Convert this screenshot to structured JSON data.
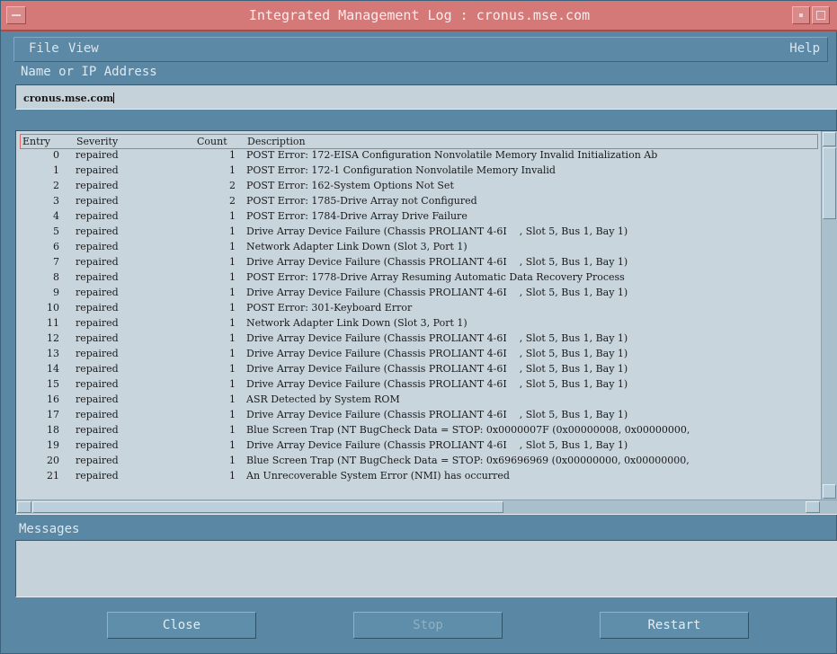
{
  "window": {
    "title": "Integrated Management Log : cronus.mse.com"
  },
  "menu": {
    "file": "File",
    "view": "View",
    "help": "Help"
  },
  "address": {
    "label": "Name or IP Address",
    "value": "cronus.mse.com"
  },
  "list": {
    "headers": {
      "entry": "Entry",
      "severity": "Severity",
      "count": "Count",
      "description": "Description"
    },
    "rows": [
      {
        "entry": "0",
        "severity": "repaired",
        "count": "1",
        "description": "POST Error: 172-EISA Configuration Nonvolatile Memory Invalid Initialization Ab"
      },
      {
        "entry": "1",
        "severity": "repaired",
        "count": "1",
        "description": "POST Error: 172-1 Configuration Nonvolatile Memory Invalid"
      },
      {
        "entry": "2",
        "severity": "repaired",
        "count": "2",
        "description": "POST Error: 162-System Options Not Set"
      },
      {
        "entry": "3",
        "severity": "repaired",
        "count": "2",
        "description": "POST Error: 1785-Drive Array not Configured"
      },
      {
        "entry": "4",
        "severity": "repaired",
        "count": "1",
        "description": "POST Error: 1784-Drive Array Drive Failure"
      },
      {
        "entry": "5",
        "severity": "repaired",
        "count": "1",
        "description": "Drive Array Device Failure (Chassis PROLIANT 4-6I    , Slot 5, Bus 1, Bay 1)"
      },
      {
        "entry": "6",
        "severity": "repaired",
        "count": "1",
        "description": "Network Adapter Link Down (Slot 3, Port 1)"
      },
      {
        "entry": "7",
        "severity": "repaired",
        "count": "1",
        "description": "Drive Array Device Failure (Chassis PROLIANT 4-6I    , Slot 5, Bus 1, Bay 1)"
      },
      {
        "entry": "8",
        "severity": "repaired",
        "count": "1",
        "description": "POST Error: 1778-Drive Array Resuming Automatic Data Recovery Process"
      },
      {
        "entry": "9",
        "severity": "repaired",
        "count": "1",
        "description": "Drive Array Device Failure (Chassis PROLIANT 4-6I    , Slot 5, Bus 1, Bay 1)"
      },
      {
        "entry": "10",
        "severity": "repaired",
        "count": "1",
        "description": "POST Error: 301-Keyboard Error"
      },
      {
        "entry": "11",
        "severity": "repaired",
        "count": "1",
        "description": "Network Adapter Link Down (Slot 3, Port 1)"
      },
      {
        "entry": "12",
        "severity": "repaired",
        "count": "1",
        "description": "Drive Array Device Failure (Chassis PROLIANT 4-6I    , Slot 5, Bus 1, Bay 1)"
      },
      {
        "entry": "13",
        "severity": "repaired",
        "count": "1",
        "description": "Drive Array Device Failure (Chassis PROLIANT 4-6I    , Slot 5, Bus 1, Bay 1)"
      },
      {
        "entry": "14",
        "severity": "repaired",
        "count": "1",
        "description": "Drive Array Device Failure (Chassis PROLIANT 4-6I    , Slot 5, Bus 1, Bay 1)"
      },
      {
        "entry": "15",
        "severity": "repaired",
        "count": "1",
        "description": "Drive Array Device Failure (Chassis PROLIANT 4-6I    , Slot 5, Bus 1, Bay 1)"
      },
      {
        "entry": "16",
        "severity": "repaired",
        "count": "1",
        "description": "ASR Detected by System ROM"
      },
      {
        "entry": "17",
        "severity": "repaired",
        "count": "1",
        "description": "Drive Array Device Failure (Chassis PROLIANT 4-6I    , Slot 5, Bus 1, Bay 1)"
      },
      {
        "entry": "18",
        "severity": "repaired",
        "count": "1",
        "description": "Blue Screen Trap (NT BugCheck Data = STOP: 0x0000007F (0x00000008, 0x00000000,"
      },
      {
        "entry": "19",
        "severity": "repaired",
        "count": "1",
        "description": "Drive Array Device Failure (Chassis PROLIANT 4-6I    , Slot 5, Bus 1, Bay 1)"
      },
      {
        "entry": "20",
        "severity": "repaired",
        "count": "1",
        "description": "Blue Screen Trap (NT BugCheck Data = STOP: 0x69696969 (0x00000000, 0x00000000,"
      },
      {
        "entry": "21",
        "severity": "repaired",
        "count": "1",
        "description": "An Unrecoverable System Error (NMI) has occurred"
      }
    ]
  },
  "messages": {
    "label": "Messages",
    "text": ""
  },
  "buttons": {
    "close": "Close",
    "stop": "Stop",
    "restart": "Restart"
  },
  "colors": {
    "title_bar": "#d47878",
    "window_bg": "#5a88a4",
    "list_bg": "#c9d5dd",
    "header_outline": "#d46a6a"
  }
}
